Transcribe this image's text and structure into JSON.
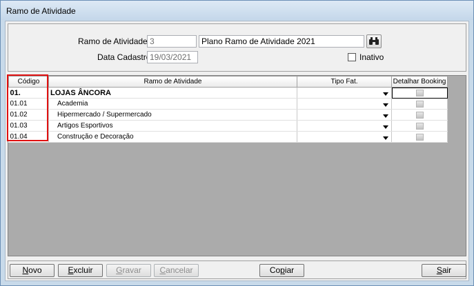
{
  "window": {
    "title": "Ramo de Atividade"
  },
  "header": {
    "ramo_label": "Ramo de Atividade:",
    "ramo_code": "3",
    "ramo_name": "Plano Ramo de Atividade 2021",
    "data_label": "Data Cadastro:",
    "data_value": "19/03/2021",
    "inativo_label": "Inativo",
    "inativo_checked": false
  },
  "grid": {
    "columns": [
      "Código",
      "Ramo de Atividade",
      "Tipo Fat.",
      "Detalhar Booking"
    ],
    "rows": [
      {
        "codigo": "01.",
        "ramo": "LOJAS ÂNCORA",
        "tipo": "",
        "group": true
      },
      {
        "codigo": "01.01",
        "ramo": "Academia",
        "tipo": "",
        "group": false
      },
      {
        "codigo": "01.02",
        "ramo": "Hipermercado / Supermercado",
        "tipo": "",
        "group": false
      },
      {
        "codigo": "01.03",
        "ramo": "Artigos Esportivos",
        "tipo": "",
        "group": false
      },
      {
        "codigo": "01.04",
        "ramo": "Construção e Decoração",
        "tipo": "",
        "group": false
      }
    ]
  },
  "buttons": {
    "novo": {
      "key": "N",
      "rest": "ovo"
    },
    "excluir": {
      "key": "E",
      "rest": "xcluir"
    },
    "gravar": {
      "key": "G",
      "rest": "ravar"
    },
    "cancelar": {
      "key": "C",
      "rest": "ancelar"
    },
    "copiar": {
      "pre": "Co",
      "key": "p",
      "rest": "iar"
    },
    "sair": {
      "key": "S",
      "rest": "air"
    }
  },
  "colors": {
    "highlight": "#e01010",
    "grid_bg": "#ababab"
  }
}
